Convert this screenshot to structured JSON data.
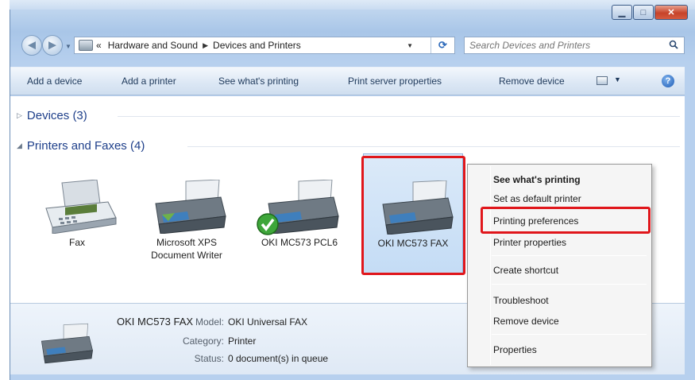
{
  "window": {
    "caption_min": "▁",
    "caption_max": "□",
    "caption_close": "✕"
  },
  "nav": {
    "back_glyph": "◀",
    "forward_glyph": "▶",
    "address_prefix": "«",
    "breadcrumb": [
      "Hardware and Sound",
      "Devices and Printers"
    ],
    "search_placeholder": "Search Devices and Printers"
  },
  "toolbar": {
    "items": [
      "Add a device",
      "Add a printer",
      "See what's printing",
      "Print server properties",
      "Remove device"
    ],
    "help_glyph": "?"
  },
  "groups": {
    "devices": "Devices (3)",
    "printers": "Printers and Faxes (4)"
  },
  "devices": [
    {
      "label": "Fax",
      "icon": "fax-icon"
    },
    {
      "label": "Microsoft XPS Document Writer",
      "icon": "printer-icon"
    },
    {
      "label": "OKI MC573 PCL6",
      "icon": "printer-icon",
      "default": true
    },
    {
      "label": "OKI MC573 FAX",
      "icon": "printer-icon",
      "selected": true
    }
  ],
  "details": {
    "name": "OKI MC573 FAX",
    "model_key": "Model:",
    "model_val": "OKI Universal FAX",
    "category_key": "Category:",
    "category_val": "Printer",
    "status_key": "Status:",
    "status_val": "0 document(s) in queue"
  },
  "context_menu": {
    "items": [
      "See what's printing",
      "Set as default printer",
      "Printing preferences",
      "Printer properties",
      "Create shortcut",
      "Troubleshoot",
      "Remove device",
      "Properties"
    ]
  },
  "colors": {
    "highlight_red": "#e0161b",
    "group_header_blue": "#1e3f8a"
  }
}
